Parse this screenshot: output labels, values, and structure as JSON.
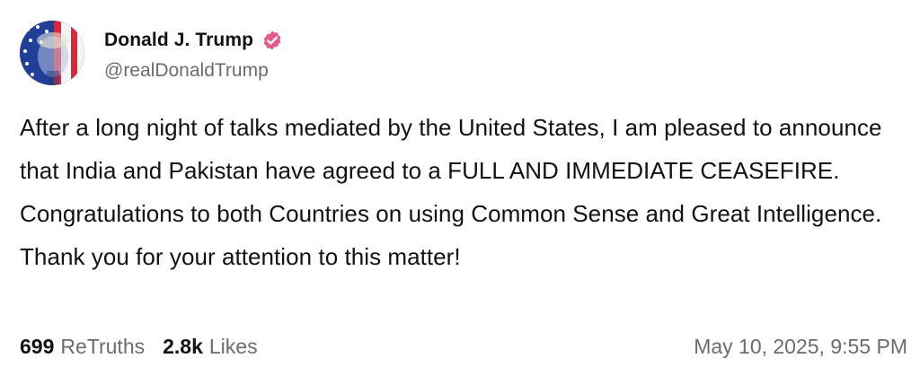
{
  "author": {
    "display_name": "Donald J. Trump",
    "handle": "@realDonaldTrump",
    "verified_color": "#e55a8a",
    "avatar_icon": "profile-avatar"
  },
  "post": {
    "text": "After a long night of talks mediated by the United States, I am pleased to announce that India and Pakistan have agreed to a FULL AND IMMEDIATE CEASEFIRE. Congratulations to both Countries on using Common Sense and Great Intelligence. Thank you for your attention to this matter!"
  },
  "stats": {
    "retruths_count": "699",
    "retruths_label": "ReTruths",
    "likes_count": "2.8k",
    "likes_label": "Likes"
  },
  "timestamp": "May 10, 2025, 9:55 PM"
}
